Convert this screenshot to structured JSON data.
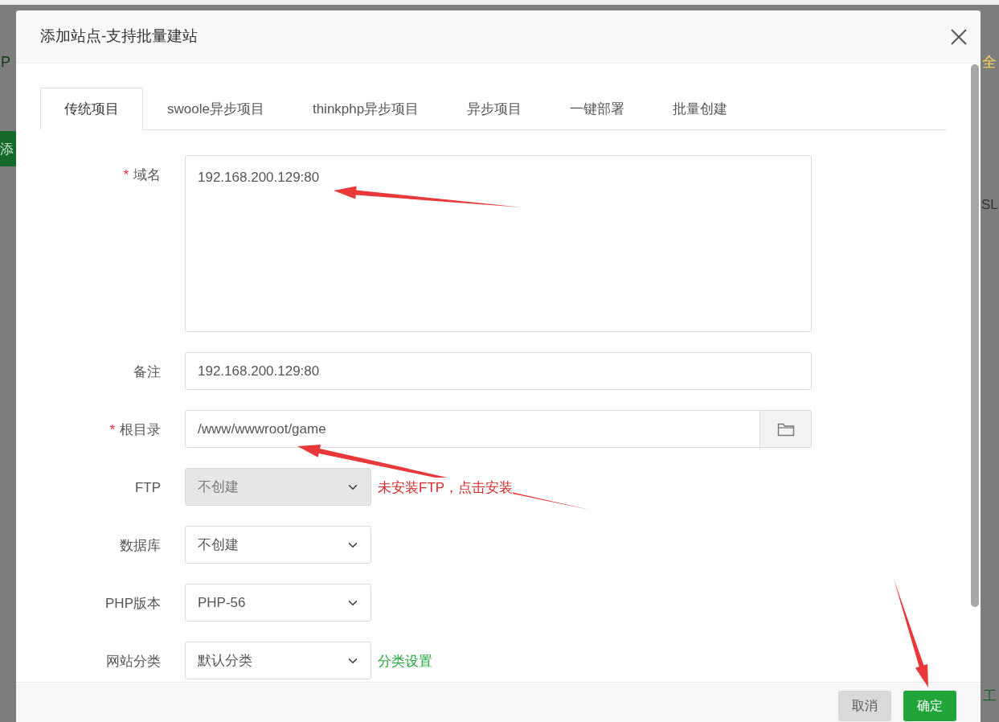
{
  "background": {
    "fragments": [
      {
        "kind": "left-heading",
        "text": "P"
      },
      {
        "kind": "left-button",
        "text": "添"
      },
      {
        "kind": "right-heading",
        "text": "全"
      },
      {
        "kind": "right-text",
        "text": "SL"
      },
      {
        "kind": "right-footer",
        "text": "工"
      }
    ]
  },
  "dialog": {
    "title": "添加站点-支持批量建站",
    "tabs": [
      {
        "label": "传统项目",
        "selected": true
      },
      {
        "label": "swoole异步项目",
        "selected": false
      },
      {
        "label": "thinkphp异步项目",
        "selected": false
      },
      {
        "label": "异步项目",
        "selected": false
      },
      {
        "label": "一键部署",
        "selected": false
      },
      {
        "label": "批量创建",
        "selected": false
      }
    ],
    "fields": [
      {
        "kind": "textarea",
        "label": "域名",
        "required_mark": "*",
        "value": "192.168.200.129:80"
      },
      {
        "kind": "input",
        "label": "备注",
        "value": "192.168.200.129:80"
      },
      {
        "kind": "path",
        "label": "根目录",
        "required_mark": "*",
        "value": "/www/wwwroot/game"
      },
      {
        "kind": "select",
        "label": "FTP",
        "value": "不创建",
        "disabled": true,
        "note": {
          "text": "未安装FTP，点击安装",
          "color": "#d52a2a"
        }
      },
      {
        "kind": "select",
        "label": "数据库",
        "value": "不创建",
        "disabled": false
      },
      {
        "kind": "select",
        "label": "PHP版本",
        "value": "PHP-56",
        "disabled": false
      },
      {
        "kind": "select",
        "label": "网站分类",
        "value": "默认分类",
        "disabled": false,
        "note": {
          "text": "分类设置",
          "color": "#20a53a"
        }
      }
    ],
    "buttons": [
      {
        "kind": "cancel",
        "label": "取消"
      },
      {
        "kind": "confirm",
        "label": "确定"
      }
    ]
  },
  "annotations": [
    {
      "kind": "arrow"
    },
    {
      "kind": "arrow"
    },
    {
      "kind": "arrow"
    }
  ]
}
